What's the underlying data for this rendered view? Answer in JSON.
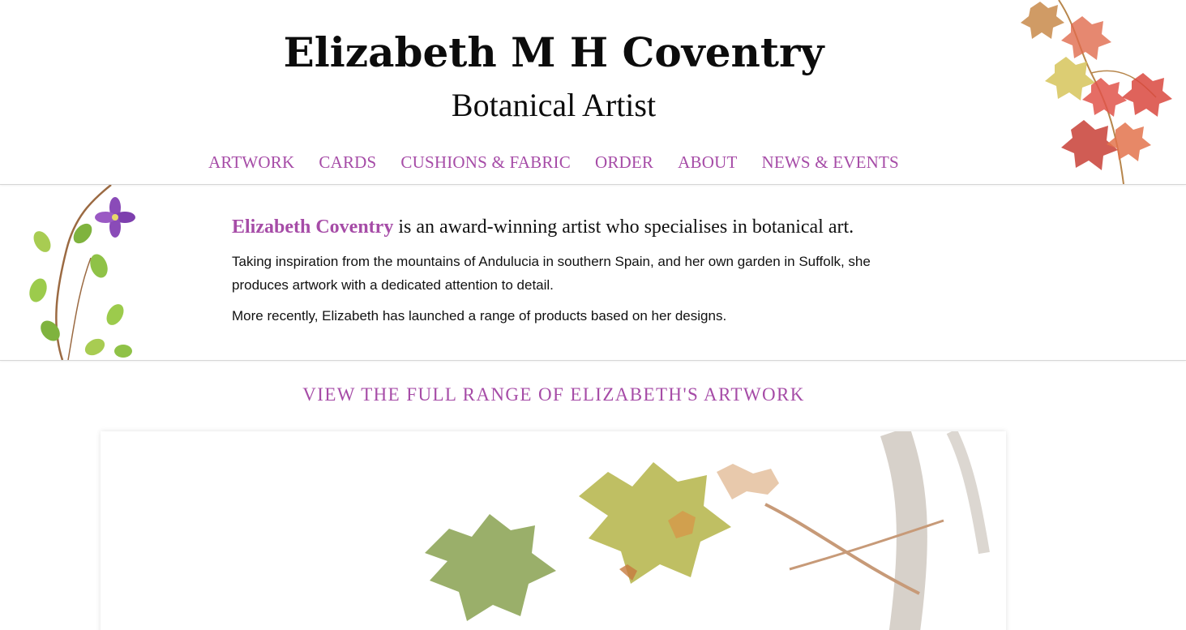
{
  "header": {
    "title": "Elizabeth M H Coventry",
    "subtitle": "Botanical Artist"
  },
  "nav": {
    "items": [
      {
        "label": "ARTWORK"
      },
      {
        "label": "CARDS"
      },
      {
        "label": "CUSHIONS & FABRIC"
      },
      {
        "label": "ORDER"
      },
      {
        "label": "ABOUT"
      },
      {
        "label": "NEWS & EVENTS"
      }
    ]
  },
  "intro": {
    "name": "Elizabeth Coventry",
    "lead_rest": " is an award-winning artist who specialises in botanical art.",
    "paragraph1": "Taking inspiration from the mountains of Andulucia in southern Spain, and her own garden in Suffolk, she produces artwork with a dedicated attention to detail.",
    "paragraph2": "More recently, Elizabeth has launched a range of products based on her designs."
  },
  "cta": {
    "label": "VIEW THE FULL RANGE OF ELIZABETH'S ARTWORK"
  },
  "colors": {
    "accent": "#a64ca7",
    "text": "#111111",
    "divider": "#d7d7d7"
  }
}
